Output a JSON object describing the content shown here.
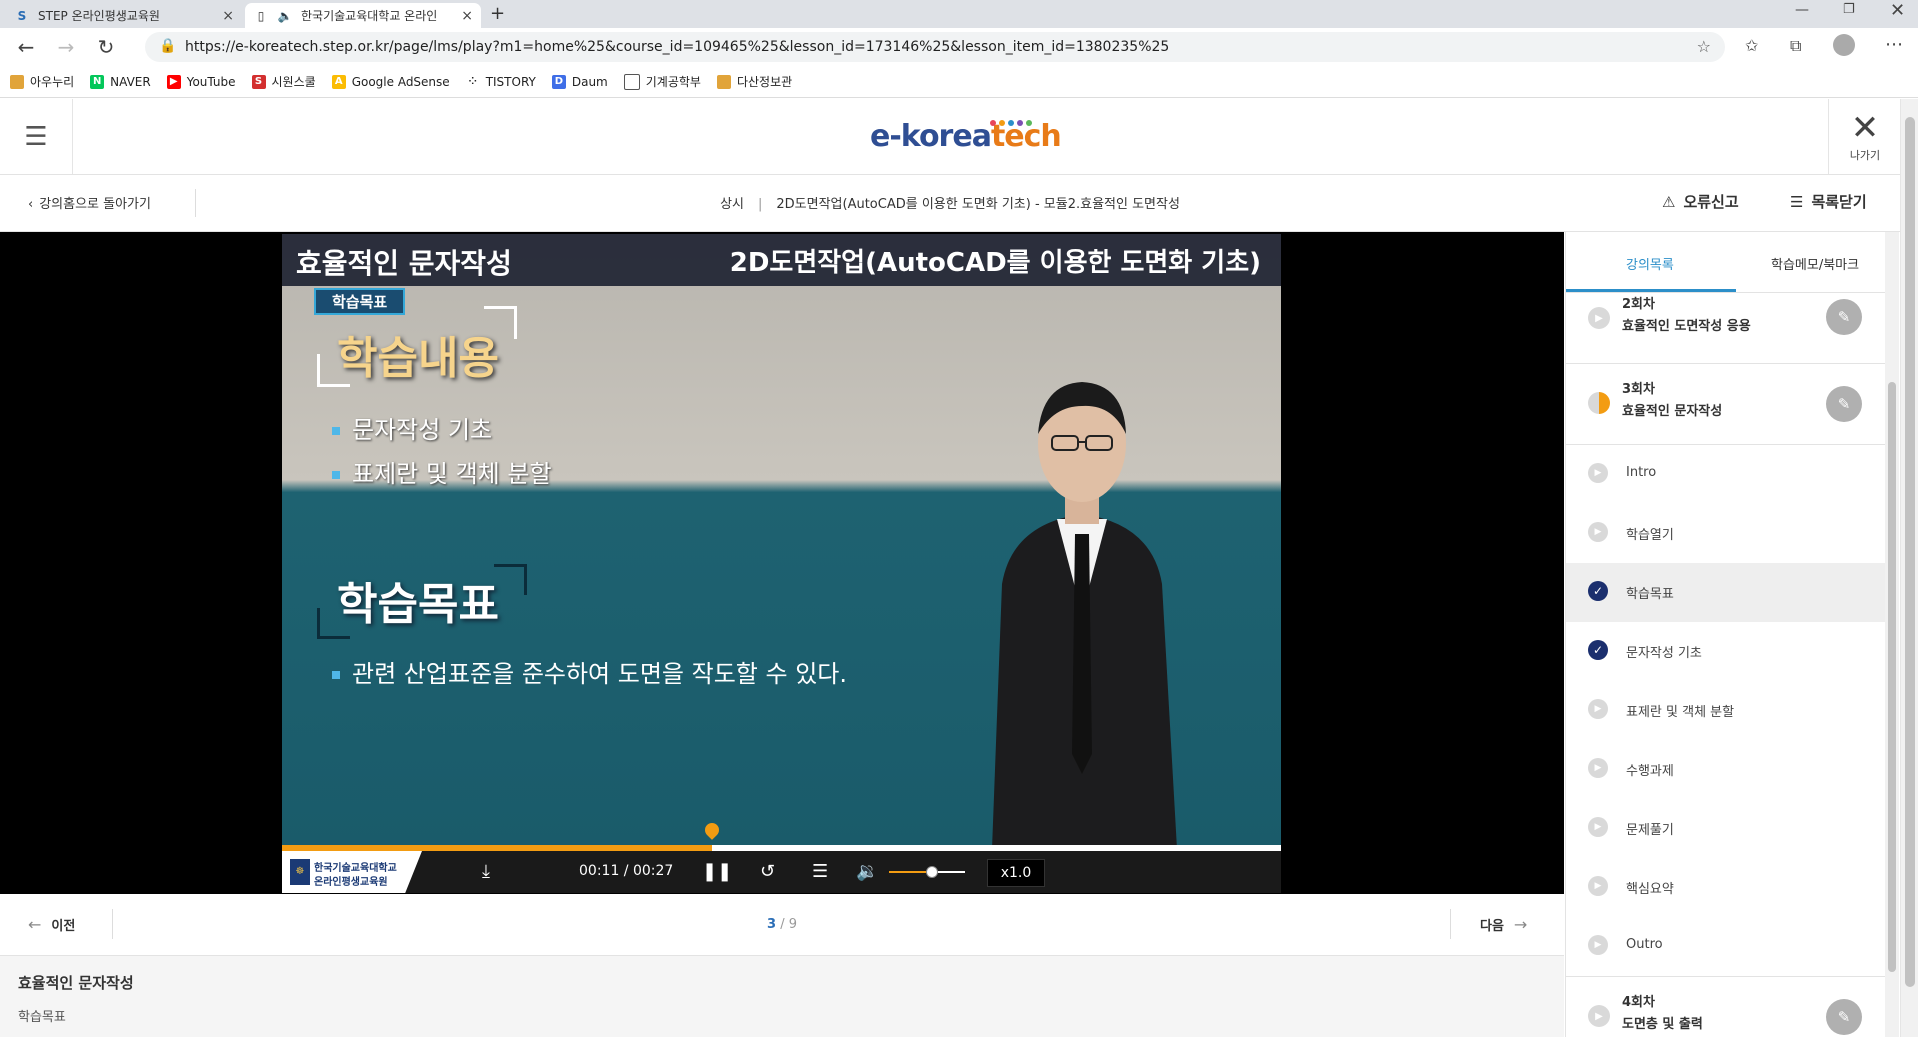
{
  "browser": {
    "tabs": [
      {
        "title": "STEP 온라인평생교육원",
        "close": "×"
      },
      {
        "title": "한국기술교육대학교 온라인",
        "close": "×"
      }
    ],
    "new_tab": "+",
    "url": "https://e-koreatech.step.or.kr/page/lms/play?m1=home%25&course_id=109465%25&lesson_id=173146%25&lesson_item_id=1380235%25",
    "bookmarks": [
      "아우누리",
      "NAVER",
      "YouTube",
      "시원스쿨",
      "Google AdSense",
      "TISTORY",
      "Daum",
      "기계공학부",
      "다산정보관"
    ]
  },
  "header": {
    "logo_main": "e-korea",
    "logo_accent": "tech",
    "exit_label": "나가기"
  },
  "subnav": {
    "back_label": "강의홈으로 돌아가기",
    "crumb_type": "상시",
    "crumb_course": "2D도면작업(AutoCAD를 이용한 도면화 기초) - 모듈2.효율적인 도면작성",
    "report_label": "오류신고",
    "close_list_label": "목록닫기"
  },
  "video": {
    "title": "효율적인 문자작성",
    "course": "2D도면작업(AutoCAD를 이용한 도면화 기초)",
    "badge": "학습목표",
    "heading1": "학습내용",
    "content_items": [
      "문자작성 기초",
      "표제란 및 객체 분할"
    ],
    "heading2": "학습목표",
    "objective": "관련 산업표준을 준수하여 도면을 작도할 수 있다.",
    "progress_fraction": 0.43,
    "current_time": "00:11",
    "total_time": "00:27",
    "volume_fraction": 0.55,
    "speed": "x1.0",
    "brand_line1": "한국기술교육대학교",
    "brand_line2": "온라인평생교육원"
  },
  "pager": {
    "prev_label": "이전",
    "next_label": "다음",
    "current": "3",
    "total": "/ 9"
  },
  "footer": {
    "title": "효율적인 문자작성",
    "subtitle": "학습목표"
  },
  "panel": {
    "tab_lectures": "강의목록",
    "tab_memo": "학습메모/북마크",
    "sessions": [
      {
        "num": "2회차",
        "name": "효율적인 도면작성 응용"
      },
      {
        "num": "3회차",
        "name": "효율적인 문자작성"
      },
      {
        "num": "4회차",
        "name": "도면층 및 출력"
      }
    ],
    "items": [
      "Intro",
      "학습열기",
      "학습목표",
      "문자작성 기초",
      "표제란 및 객체 분할",
      "수행과제",
      "문제풀기",
      "핵심요약",
      "Outro"
    ]
  },
  "colors": {
    "accent_blue": "#2c8fc9",
    "progress_orange": "#f39c12",
    "done_navy": "#1b2f6e"
  }
}
